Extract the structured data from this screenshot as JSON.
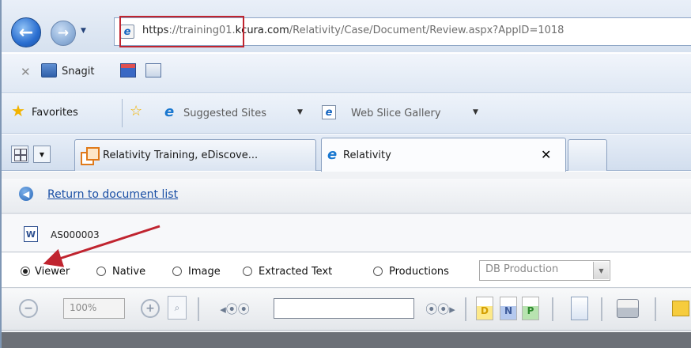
{
  "browser": {
    "url": {
      "scheme": "https",
      "separator": "://",
      "subdomain": "training01.",
      "host": "kcura.com",
      "path": "/Relativity/Case/Document/Review.aspx?AppID=1018"
    },
    "command_bar": {
      "snagit_label": "Snagit"
    },
    "favorites_bar": {
      "favorites_label": "Favorites",
      "suggested_sites_label": "Suggested Sites",
      "web_slice_gallery_label": "Web Slice Gallery"
    },
    "tabs": [
      {
        "label": "Relativity Training, eDiscove...",
        "active": false
      },
      {
        "label": "Relativity",
        "active": true
      }
    ]
  },
  "page": {
    "return_link": "Return to document list",
    "document_name": "AS000003",
    "view_modes": [
      {
        "label": "Viewer",
        "selected": true
      },
      {
        "label": "Native",
        "selected": false
      },
      {
        "label": "Image",
        "selected": false
      },
      {
        "label": "Extracted Text",
        "selected": false
      },
      {
        "label": "Productions",
        "selected": false
      }
    ],
    "production_select_value": "DB Production",
    "toolbar": {
      "zoom_value": "100%",
      "find_value": ""
    }
  },
  "annotation": {
    "highlight_color": "#c0242f",
    "arrow_color": "#c0242f"
  }
}
